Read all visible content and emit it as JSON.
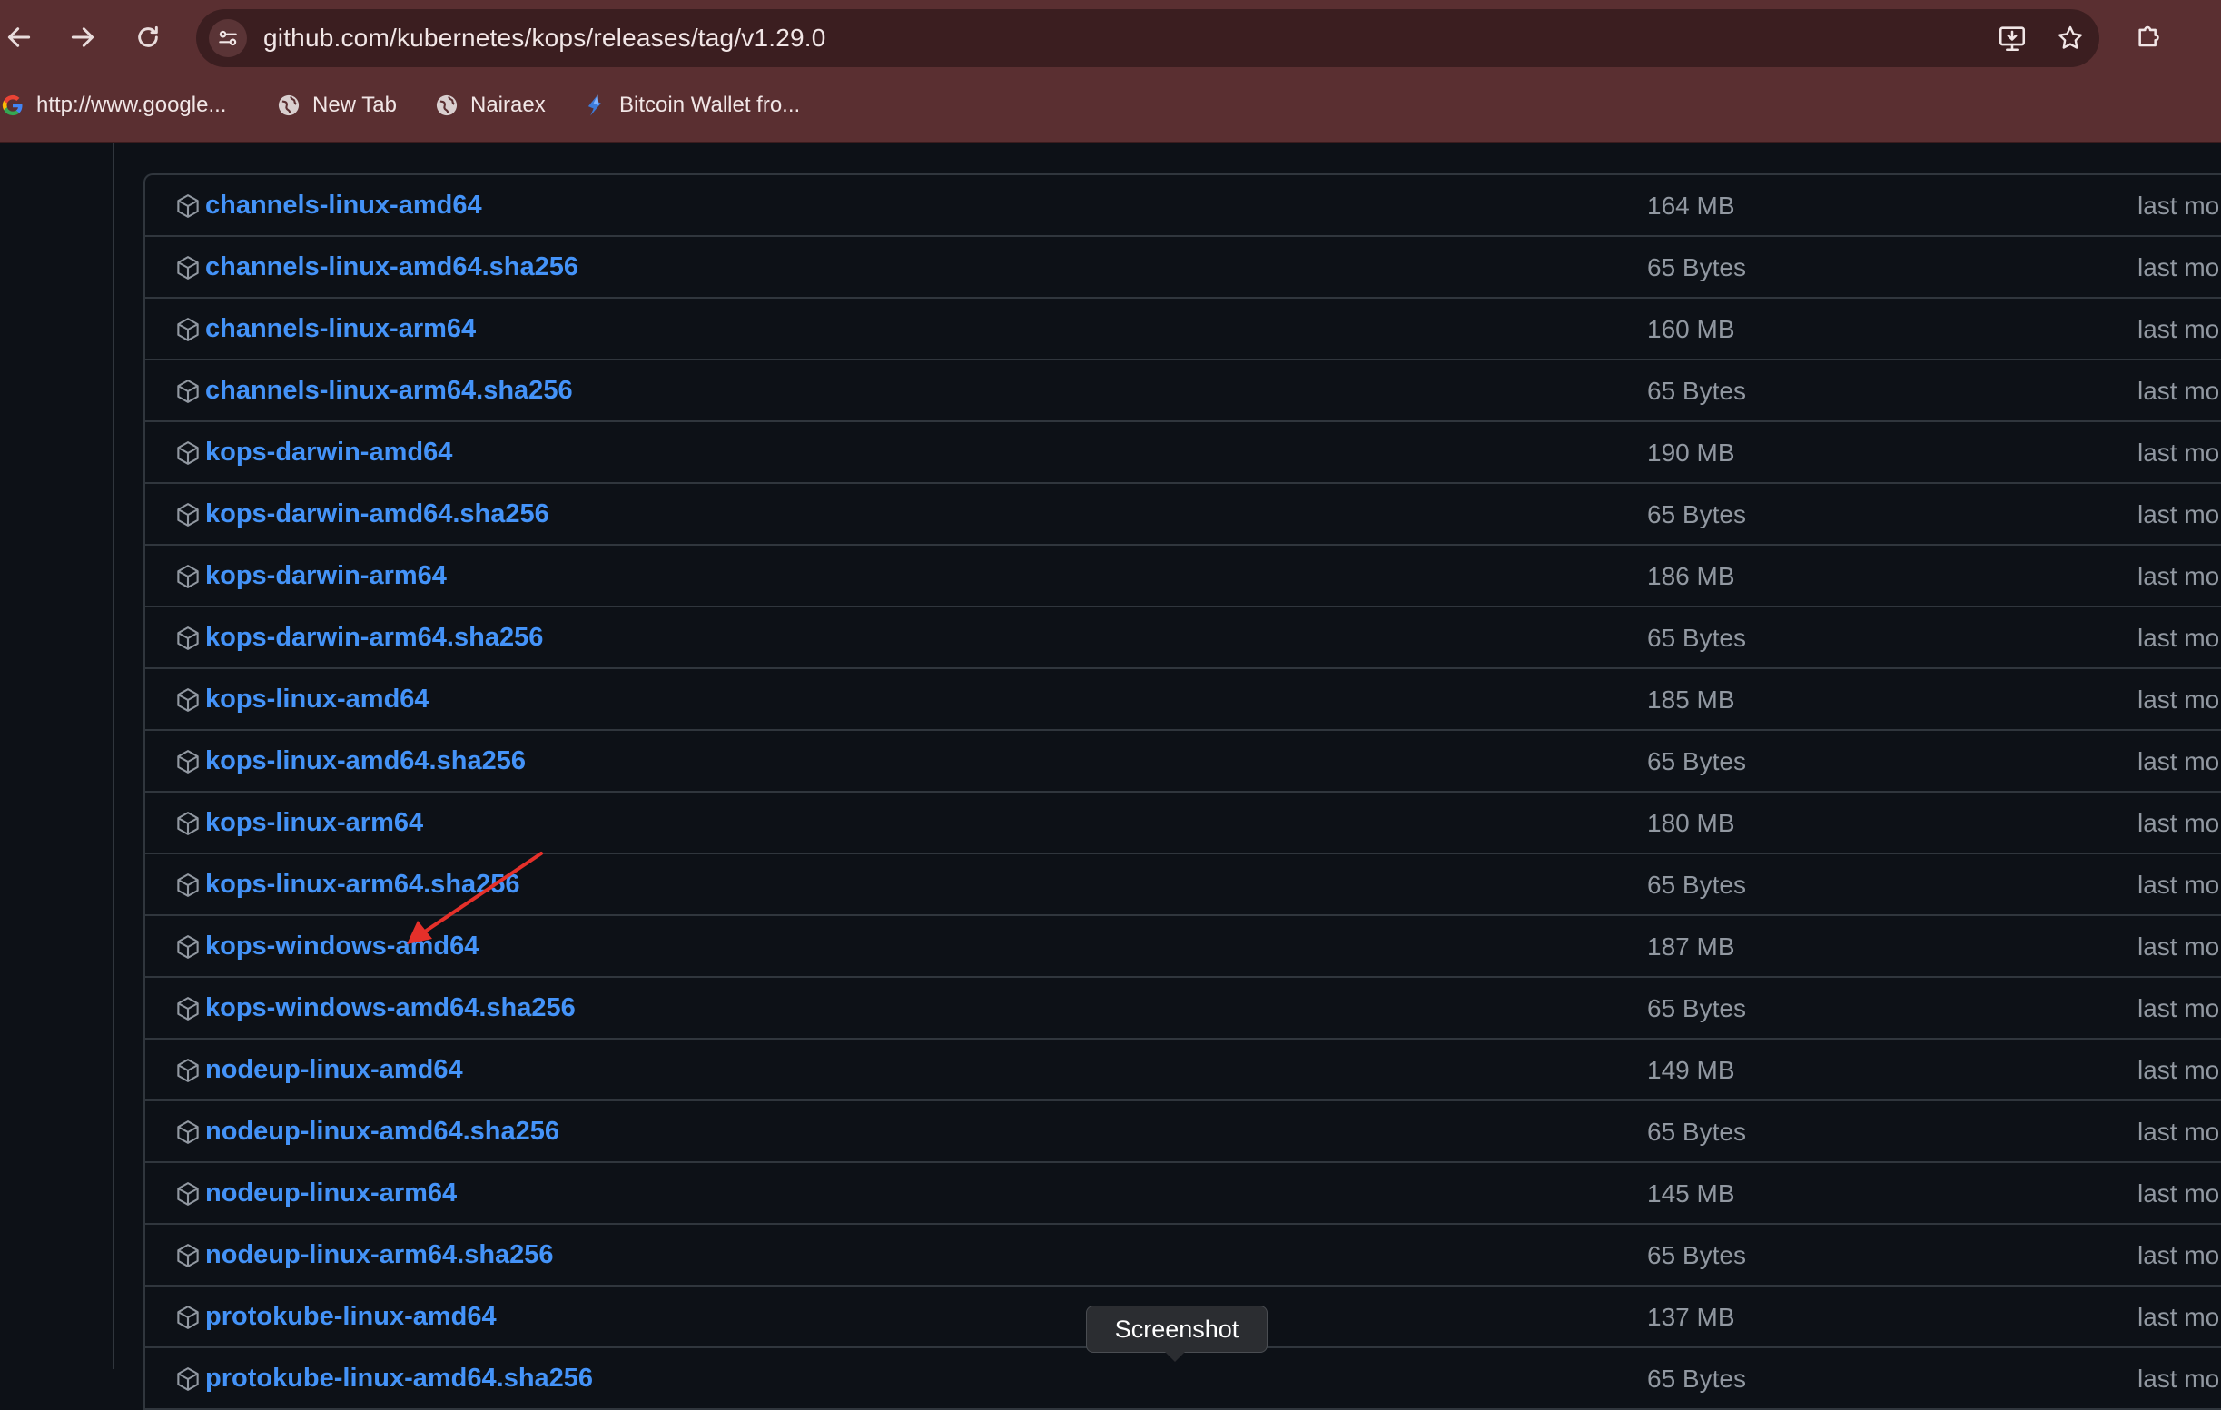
{
  "browser": {
    "url": "github.com/kubernetes/kops/releases/tag/v1.29.0",
    "bookmarks": [
      {
        "label": "http://www.google...",
        "icon": "google-icon"
      },
      {
        "label": "New Tab",
        "icon": "globe-icon"
      },
      {
        "label": "Nairaex",
        "icon": "globe-icon"
      },
      {
        "label": "Bitcoin Wallet fro...",
        "icon": "wallet-icon"
      }
    ]
  },
  "assets": [
    {
      "name": "channels-linux-amd64",
      "size": "164 MB",
      "date": "last mo"
    },
    {
      "name": "channels-linux-amd64.sha256",
      "size": "65 Bytes",
      "date": "last mo"
    },
    {
      "name": "channels-linux-arm64",
      "size": "160 MB",
      "date": "last mo"
    },
    {
      "name": "channels-linux-arm64.sha256",
      "size": "65 Bytes",
      "date": "last mo"
    },
    {
      "name": "kops-darwin-amd64",
      "size": "190 MB",
      "date": "last mo"
    },
    {
      "name": "kops-darwin-amd64.sha256",
      "size": "65 Bytes",
      "date": "last mo"
    },
    {
      "name": "kops-darwin-arm64",
      "size": "186 MB",
      "date": "last mo"
    },
    {
      "name": "kops-darwin-arm64.sha256",
      "size": "65 Bytes",
      "date": "last mo"
    },
    {
      "name": "kops-linux-amd64",
      "size": "185 MB",
      "date": "last mo"
    },
    {
      "name": "kops-linux-amd64.sha256",
      "size": "65 Bytes",
      "date": "last mo"
    },
    {
      "name": "kops-linux-arm64",
      "size": "180 MB",
      "date": "last mo"
    },
    {
      "name": "kops-linux-arm64.sha256",
      "size": "65 Bytes",
      "date": "last mo"
    },
    {
      "name": "kops-windows-amd64",
      "size": "187 MB",
      "date": "last mo"
    },
    {
      "name": "kops-windows-amd64.sha256",
      "size": "65 Bytes",
      "date": "last mo"
    },
    {
      "name": "nodeup-linux-amd64",
      "size": "149 MB",
      "date": "last mo"
    },
    {
      "name": "nodeup-linux-amd64.sha256",
      "size": "65 Bytes",
      "date": "last mo"
    },
    {
      "name": "nodeup-linux-arm64",
      "size": "145 MB",
      "date": "last mo"
    },
    {
      "name": "nodeup-linux-arm64.sha256",
      "size": "65 Bytes",
      "date": "last mo"
    },
    {
      "name": "protokube-linux-amd64",
      "size": "137 MB",
      "date": "last mo"
    },
    {
      "name": "protokube-linux-amd64.sha256",
      "size": "65 Bytes",
      "date": "last mo"
    }
  ],
  "tooltip": {
    "label": "Screenshot"
  },
  "colors": {
    "link": "#4493f8",
    "muted": "#9198a1",
    "border": "#30363d",
    "chrome": "#5a2f31",
    "annotation": "#e5302a"
  }
}
